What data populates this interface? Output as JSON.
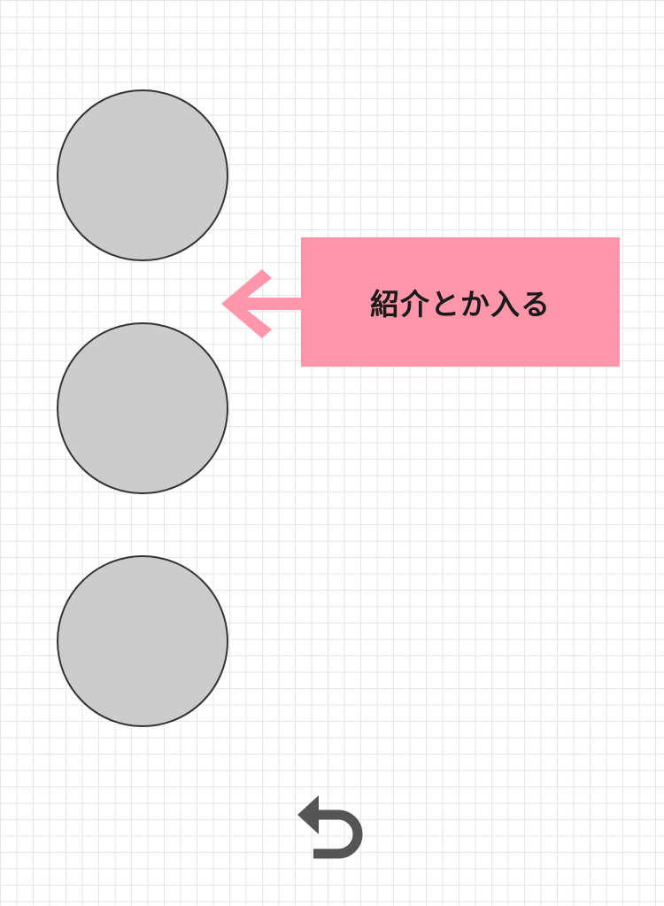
{
  "annotation": {
    "label": "紹介とか入る",
    "background_color": "#ff96aa"
  },
  "placeholders": [
    {
      "name": "placeholder-circle-1"
    },
    {
      "name": "placeholder-circle-2"
    },
    {
      "name": "placeholder-circle-3"
    }
  ],
  "icons": {
    "arrow": "left-arrow-icon",
    "back": "undo-back-icon"
  },
  "colors": {
    "circle_fill": "#cccccc",
    "circle_border": "#333333",
    "arrow": "#ff96aa",
    "back_icon": "#555555"
  }
}
